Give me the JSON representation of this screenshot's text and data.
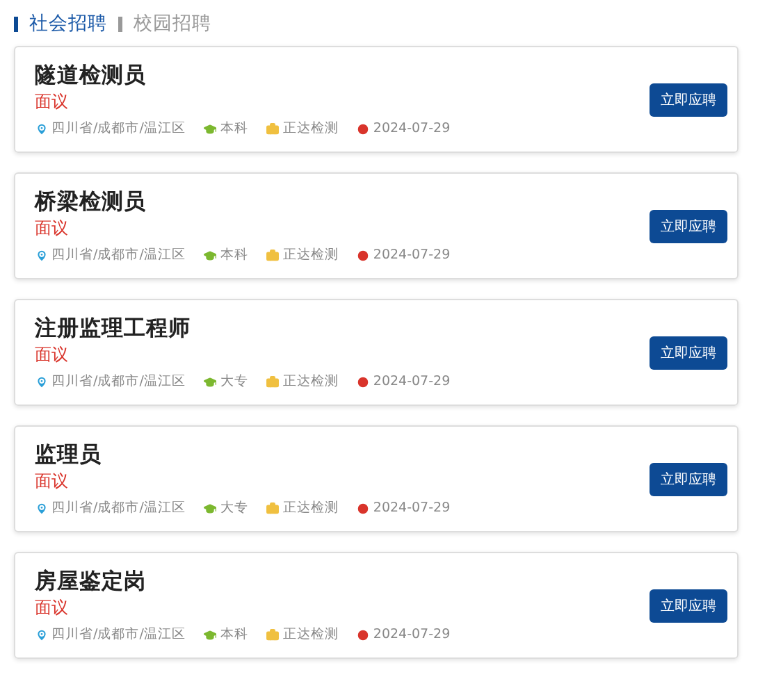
{
  "tabs": [
    {
      "label": "社会招聘",
      "selected": true
    },
    {
      "label": "校园招聘",
      "selected": false
    }
  ],
  "jobs": [
    {
      "title": "隧道检测员",
      "salary": "面议",
      "location": "四川省/成都市/温江区",
      "education": "本科",
      "company": "正达检测",
      "date": "2024-07-29",
      "button": "立即应聘"
    },
    {
      "title": "桥梁检测员",
      "salary": "面议",
      "location": "四川省/成都市/温江区",
      "education": "本科",
      "company": "正达检测",
      "date": "2024-07-29",
      "button": "立即应聘"
    },
    {
      "title": "注册监理工程师",
      "salary": "面议",
      "location": "四川省/成都市/温江区",
      "education": "大专",
      "company": "正达检测",
      "date": "2024-07-29",
      "button": "立即应聘"
    },
    {
      "title": "监理员",
      "salary": "面议",
      "location": "四川省/成都市/温江区",
      "education": "大专",
      "company": "正达检测",
      "date": "2024-07-29",
      "button": "立即应聘"
    },
    {
      "title": "房屋鉴定岗",
      "salary": "面议",
      "location": "四川省/成都市/温江区",
      "education": "本科",
      "company": "正达检测",
      "date": "2024-07-29",
      "button": "立即应聘"
    }
  ]
}
